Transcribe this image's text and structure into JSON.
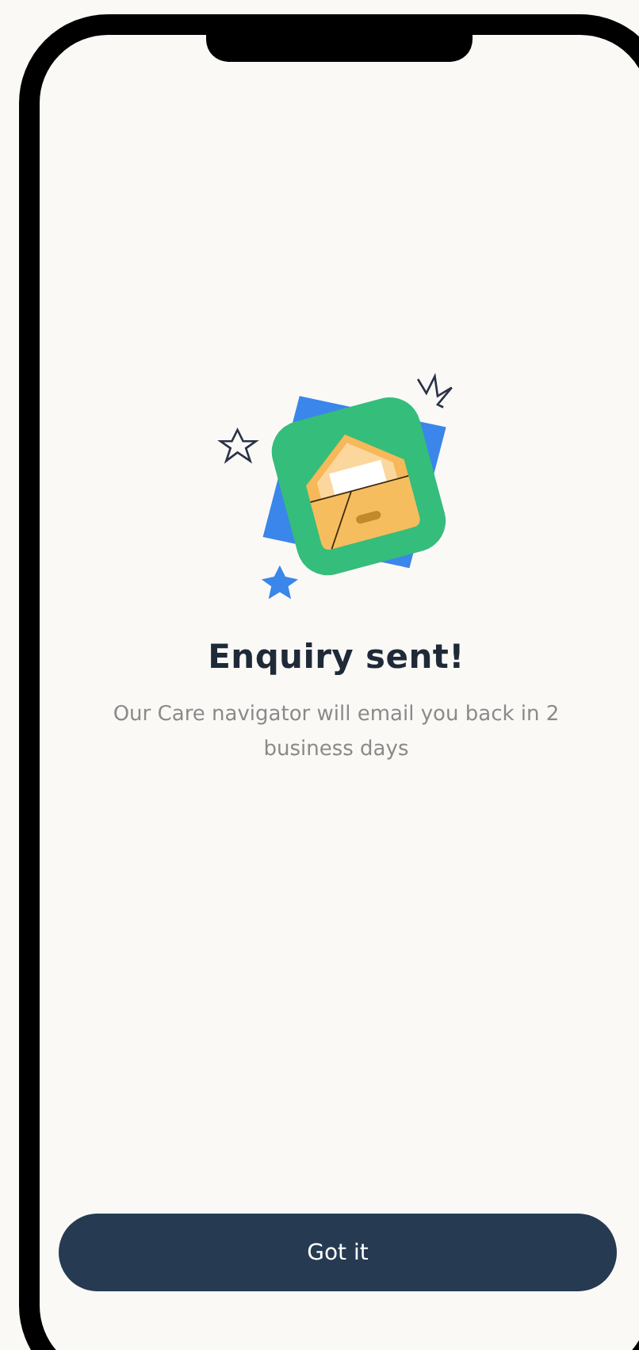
{
  "title": "Enquiry sent!",
  "message": "Our Care navigator will email you back in 2 business days",
  "button": {
    "label": "Got it"
  }
}
